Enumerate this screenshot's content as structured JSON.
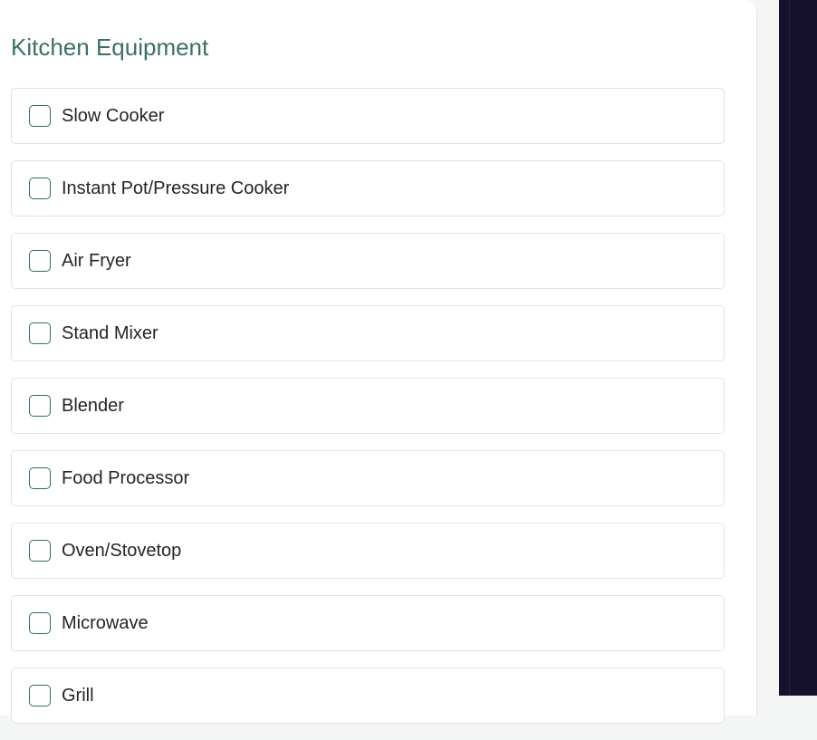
{
  "section": {
    "title": "Kitchen Equipment"
  },
  "equipment": [
    {
      "label": "Slow Cooker",
      "checked": false
    },
    {
      "label": "Instant Pot/Pressure Cooker",
      "checked": false
    },
    {
      "label": "Air Fryer",
      "checked": false
    },
    {
      "label": "Stand Mixer",
      "checked": false
    },
    {
      "label": "Blender",
      "checked": false
    },
    {
      "label": "Food Processor",
      "checked": false
    },
    {
      "label": "Oven/Stovetop",
      "checked": false
    },
    {
      "label": "Microwave",
      "checked": false
    },
    {
      "label": "Grill",
      "checked": false
    }
  ],
  "colors": {
    "accent": "#3a7068",
    "checkbox_border": "#2f6e66",
    "sidebar_dark": "#16122e"
  }
}
